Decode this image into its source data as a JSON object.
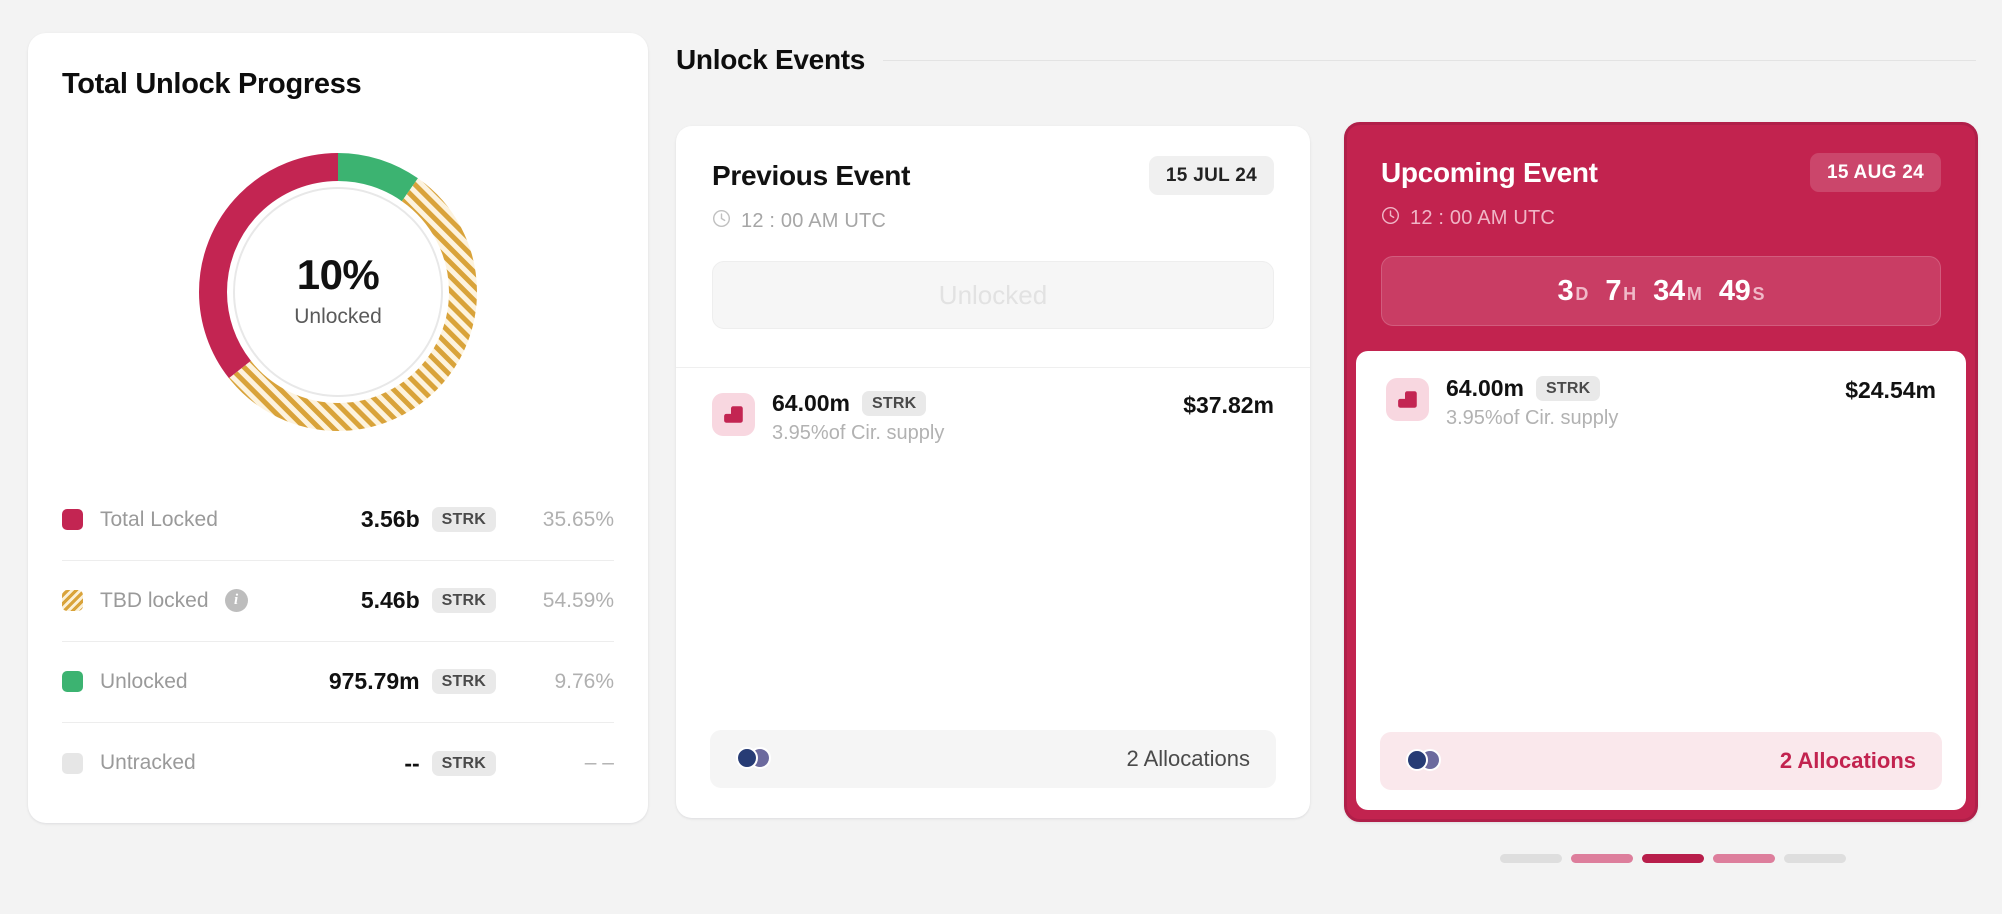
{
  "progress_card": {
    "title": "Total Unlock Progress",
    "donut": {
      "center_value": "10%",
      "center_label": "Unlocked"
    },
    "legend": [
      {
        "label": "Total Locked",
        "swatch": "crimson-swatch",
        "amount": "3.56b",
        "ticker": "STRK",
        "percent": "35.65%",
        "has_info": false,
        "info": ""
      },
      {
        "label": "TBD locked",
        "swatch": "gold-hatch-swatch",
        "amount": "5.46b",
        "ticker": "STRK",
        "percent": "54.59%",
        "has_info": true,
        "info": "i"
      },
      {
        "label": "Unlocked",
        "swatch": "green-swatch",
        "amount": "975.79m",
        "ticker": "STRK",
        "percent": "9.76%",
        "has_info": false,
        "info": ""
      },
      {
        "label": "Untracked",
        "swatch": "grey-swatch",
        "amount": "--",
        "ticker": "STRK",
        "percent": "– –",
        "has_info": false,
        "info": ""
      }
    ]
  },
  "events": {
    "section_title": "Unlock Events",
    "previous": {
      "title": "Previous Event",
      "date_chip": "15 JUL 24",
      "time": "12 : 00 AM UTC",
      "status_banner": "Unlocked",
      "token": {
        "amount": "64.00m",
        "ticker": "STRK",
        "subtitle": "3.95%of Cir. supply",
        "usd_value": "$37.82m"
      },
      "allocations_label": "2 Allocations"
    },
    "upcoming": {
      "title": "Upcoming Event",
      "date_chip": "15 AUG 24",
      "time": "12 : 00 AM UTC",
      "countdown": [
        {
          "value": "3",
          "unit": "D"
        },
        {
          "value": "7",
          "unit": "H"
        },
        {
          "value": "34",
          "unit": "M"
        },
        {
          "value": "49",
          "unit": "S"
        }
      ],
      "token": {
        "amount": "64.00m",
        "ticker": "STRK",
        "subtitle": "3.95%of Cir. supply",
        "usd_value": "$24.54m"
      },
      "allocations_label": "2 Allocations"
    },
    "pagination": [
      {
        "state": "inactive",
        "color": "#dedede"
      },
      {
        "state": "near",
        "color": "#dd7e9c"
      },
      {
        "state": "active",
        "color": "#b81e4b"
      },
      {
        "state": "near",
        "color": "#dd7e9c"
      },
      {
        "state": "inactive",
        "color": "#dedede"
      }
    ]
  },
  "chart_data": {
    "type": "pie",
    "title": "Total Unlock Progress",
    "center_text": "10% Unlocked",
    "categories": [
      "Unlocked",
      "TBD locked",
      "Total Locked",
      "Untracked"
    ],
    "values": [
      9.76,
      54.59,
      35.65,
      0
    ],
    "units": "percent of total supply",
    "amounts": [
      "975.79m STRK",
      "5.46b STRK",
      "3.56b STRK",
      "-- STRK"
    ],
    "colors": [
      "#3cb371",
      "#d9a33a",
      "#c32552",
      "#e6e6e6"
    ],
    "legend_position": "below",
    "donut": true,
    "start_angle_deg": 0,
    "direction": "clockwise"
  },
  "colors": {
    "brand_crimson": "#c2234f",
    "locked_crimson": "#c32552",
    "tbd_gold": "#d9a33a",
    "unlocked_green": "#3cb371",
    "untracked_grey": "#e6e6e6",
    "page_bg": "#f3f3f3"
  }
}
